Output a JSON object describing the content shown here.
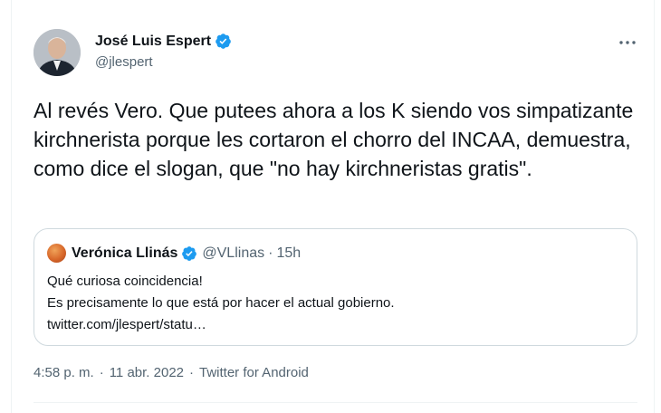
{
  "author": {
    "name": "José Luis Espert",
    "handle": "@jlespert",
    "verified": true
  },
  "tweet": {
    "text": "Al revés Vero. Que putees ahora a los K siendo vos simpatizante kirchnerista porque les cortaron el chorro del INCAA, demuestra, como dice el slogan, que \"no hay kirchneristas gratis\"."
  },
  "quoted_tweet": {
    "name": "Verónica Llinás",
    "handle": "@VLlinas",
    "separator": "·",
    "time": "15h",
    "verified": true,
    "lines": [
      "Qué curiosa coincidencia!",
      "Es precisamente lo que está por hacer el actual gobierno.",
      "twitter.com/jlespert/statu…"
    ]
  },
  "meta": {
    "time": "4:58 p. m.",
    "separator": "·",
    "date": "11 abr. 2022",
    "source": "Twitter for Android"
  },
  "colors": {
    "verified": "#1d9bf0",
    "secondary_text": "#536471",
    "border": "#cfd9de"
  },
  "icons": {
    "more": "more-horizontal-icon",
    "verified": "verified-badge-icon"
  }
}
